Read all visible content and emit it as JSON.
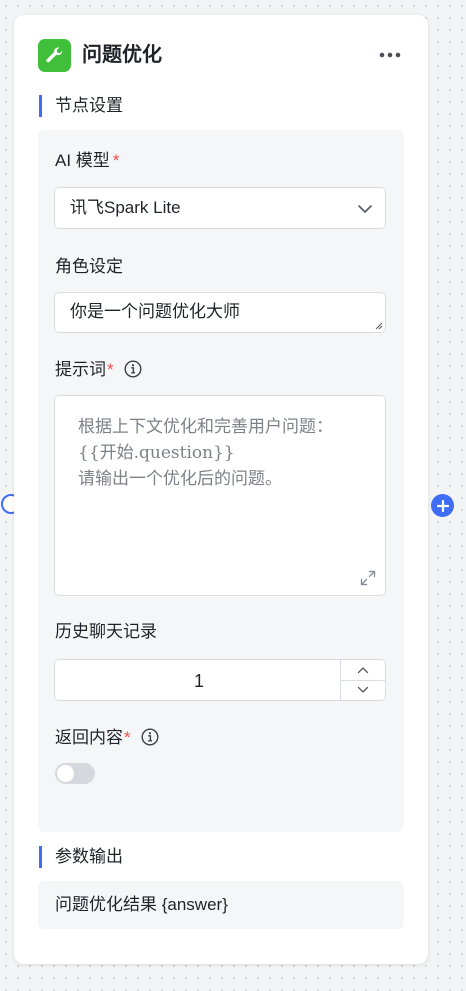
{
  "node": {
    "title": "问题优化",
    "icon": "wrench-icon",
    "accent_color": "#3fbf3a"
  },
  "sections": {
    "settings_title": "节点设置",
    "output_title": "参数输出"
  },
  "fields": {
    "model": {
      "label": "AI 模型",
      "required_mark": "*",
      "value": "讯飞Spark Lite"
    },
    "role": {
      "label": "角色设定",
      "value": "你是一个问题优化大师"
    },
    "prompt": {
      "label": "提示词",
      "required_mark": "*",
      "value": "根据上下文优化和完善用户问题：\n{{开始.question}}\n请输出一个优化后的问题。"
    },
    "history": {
      "label": "历史聊天记录",
      "value": "1"
    },
    "return_content": {
      "label": "返回内容",
      "required_mark": "*",
      "enabled": false
    }
  },
  "output": {
    "text": "问题优化结果 {answer}"
  },
  "colors": {
    "primary": "#3f6df5",
    "required": "#f24e4e",
    "toggle_off": "#d5d8dd"
  }
}
